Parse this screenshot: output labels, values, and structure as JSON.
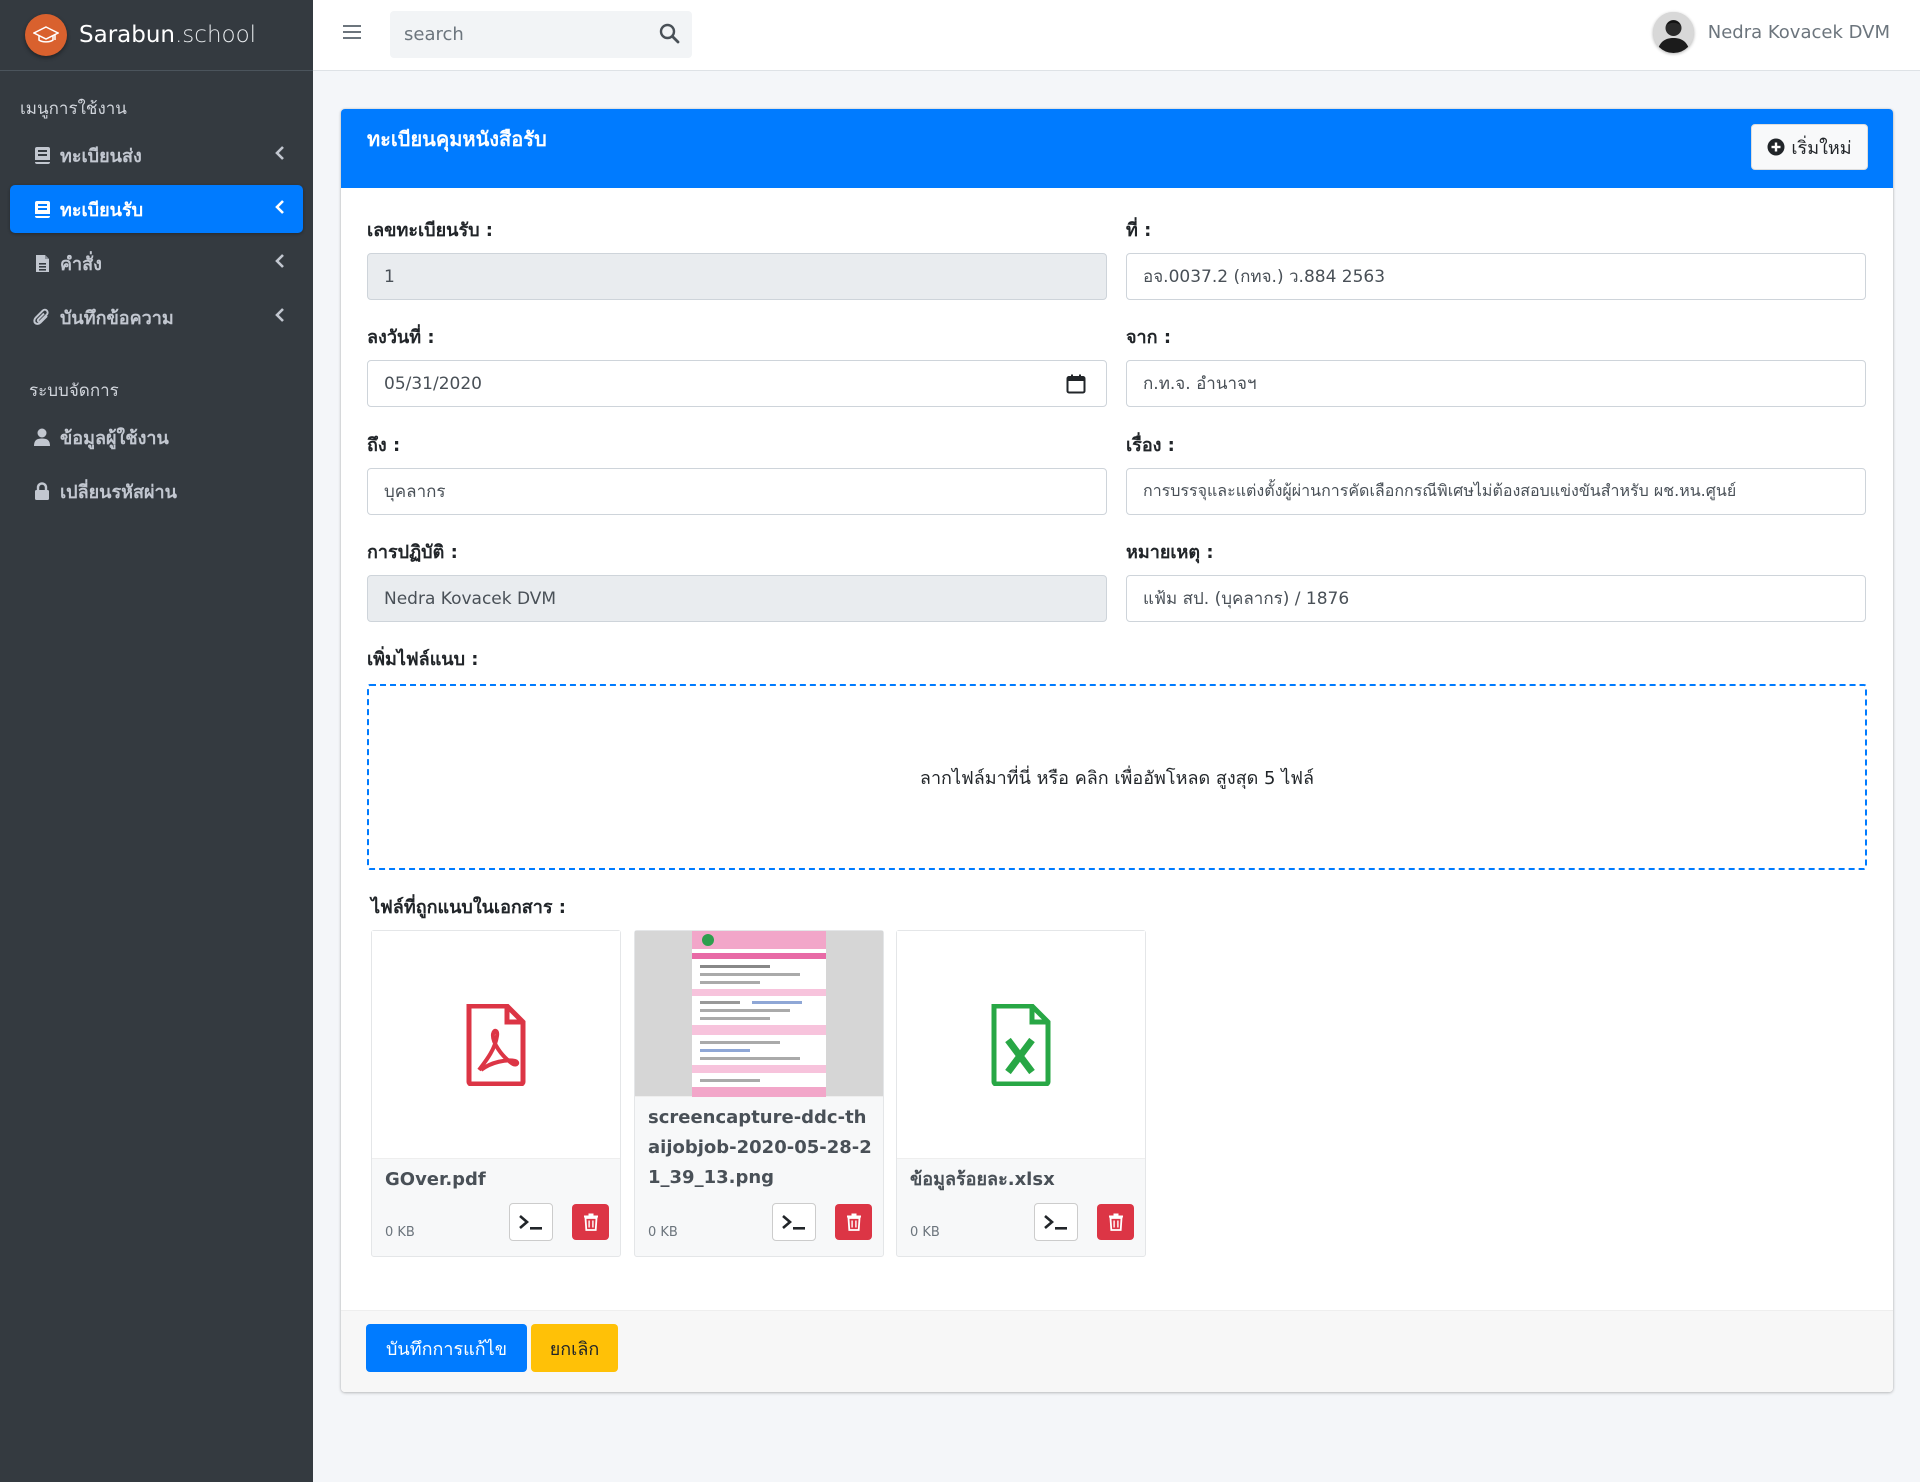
{
  "brand": {
    "name_part1": "Sarabun",
    "name_part2": ".school"
  },
  "sidebar": {
    "section1": "เมนูการใช้งาน",
    "items1": [
      {
        "label": "ทะเบียนส่ง",
        "icon": "book-icon",
        "active": false
      },
      {
        "label": "ทะเบียนรับ",
        "icon": "book-icon",
        "active": true
      },
      {
        "label": "คำสั่ง",
        "icon": "file-icon",
        "active": false
      },
      {
        "label": "บันทึกข้อความ",
        "icon": "paperclip-icon",
        "active": false
      }
    ],
    "section2": "ระบบจัดการ",
    "items2": [
      {
        "label": "ข้อมูลผู้ใช้งาน",
        "icon": "user-icon"
      },
      {
        "label": "เปลี่ยนรหัสผ่าน",
        "icon": "lock-icon"
      }
    ]
  },
  "topbar": {
    "search_placeholder": "search",
    "user_name": "Nedra Kovacek DVM"
  },
  "card": {
    "title": "ทะเบียนคุมหนังสือรับ",
    "new_button": "เริ่มใหม่",
    "fields": {
      "reg_no_label": "เลขทะเบียนรับ :",
      "reg_no_value": "1",
      "ref_label": "ที่ :",
      "ref_value": "อจ.0037.2 (กทจ.) ว.884 2563",
      "date_label": "ลงวันที่ :",
      "date_value": "05/31/2020",
      "from_label": "จาก :",
      "from_value": "ก.ท.จ. อำนาจฯ",
      "to_label": "ถึง :",
      "to_value": "บุคลากร",
      "subject_label": "เรื่อง :",
      "subject_value": "การบรรจุและแต่งตั้งผู้ผ่านการคัดเลือกกรณีพิเศษไม่ต้องสอบแข่งขันสำหรับ ผช.หน.ศูนย์",
      "action_label": "การปฏิบัติ :",
      "action_value": "Nedra Kovacek DVM",
      "note_label": "หมายเหตุ :",
      "note_value": "แฟ้ม สป. (บุคลากร) / 1876"
    },
    "attach_label": "เพิ่มไฟล์แนบ :",
    "dropzone_text": "ลากไฟล์มาที่นี่ หรือ คลิก เพื่ออัพโหลด สูงสุด 5 ไฟล์",
    "attached_label": "ไฟล์ที่ถูกแนบในเอกสาร :",
    "files": [
      {
        "name": "GOver.pdf",
        "size": "0 KB",
        "type": "pdf"
      },
      {
        "name": "screencapture-ddc-thaijobjob-2020-05-28-21_39_13.png",
        "size": "0 KB",
        "type": "image"
      },
      {
        "name": "ข้อมูลร้อยละ.xlsx",
        "size": "0 KB",
        "type": "excel"
      }
    ],
    "save_button": "บันทึกการแก้ไข",
    "cancel_button": "ยกเลิก"
  },
  "colors": {
    "primary": "#007bff",
    "sidebar": "#343a40",
    "danger": "#dc3545",
    "warning": "#ffc107",
    "pdf": "#dc3545",
    "excel": "#28a745"
  }
}
